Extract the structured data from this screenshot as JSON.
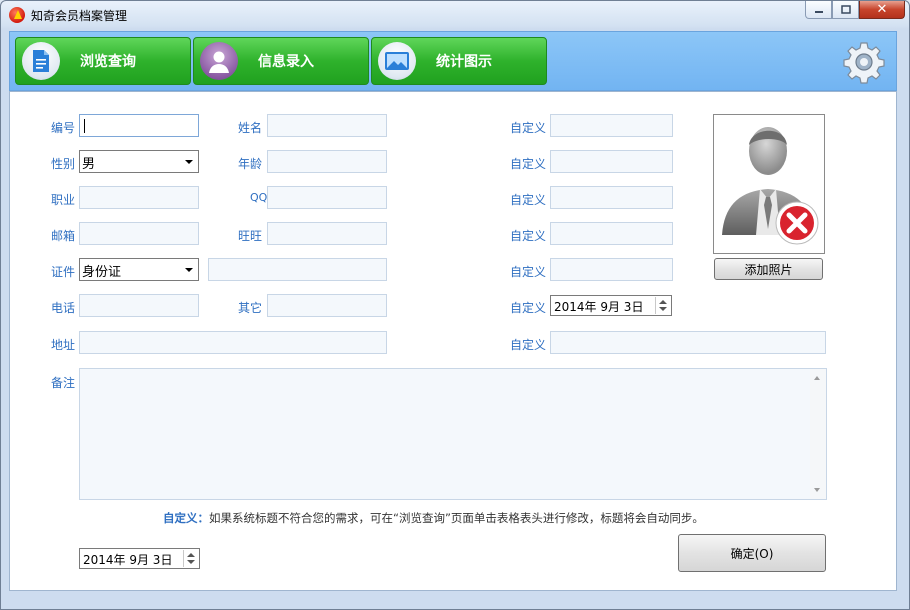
{
  "window": {
    "title": "知奇会员档案管理",
    "buttons": {
      "minimize": "▭",
      "maximize": "▢",
      "close": "✕"
    }
  },
  "toolbar": {
    "tabs": [
      {
        "label": "浏览查询",
        "icon": "document-icon"
      },
      {
        "label": "信息录入",
        "icon": "user-icon"
      },
      {
        "label": "统计图示",
        "icon": "picture-icon"
      }
    ],
    "settings_icon": "gear-icon"
  },
  "form": {
    "id_label": "编号",
    "gender_label": "性别",
    "gender_value": "男",
    "job_label": "职业",
    "email_label": "邮箱",
    "cert_label": "证件",
    "cert_type_value": "身份证",
    "phone_label": "电话",
    "address_label": "地址",
    "name_label": "姓名",
    "age_label": "年龄",
    "qq_label": "QQ",
    "wangwang_label": "旺旺",
    "other_label": "其它",
    "custom_label": "自定义",
    "custom_date_value": "2014年  9月  3日",
    "remark_label": "备注"
  },
  "photo": {
    "add_button": "添加照片"
  },
  "note": {
    "bold": "自定义：",
    "text": "如果系统标题不符合您的需求，可在“浏览查询”页面单击表格表头进行修改，标题将会自动同步。"
  },
  "footer": {
    "date_value": "2014年  9月  3日",
    "confirm_button": "确定(O)"
  },
  "colors": {
    "label_blue": "#2f6fc1",
    "tab_green": "#2fb22c",
    "toolbar_blue": "#72b4f2"
  }
}
